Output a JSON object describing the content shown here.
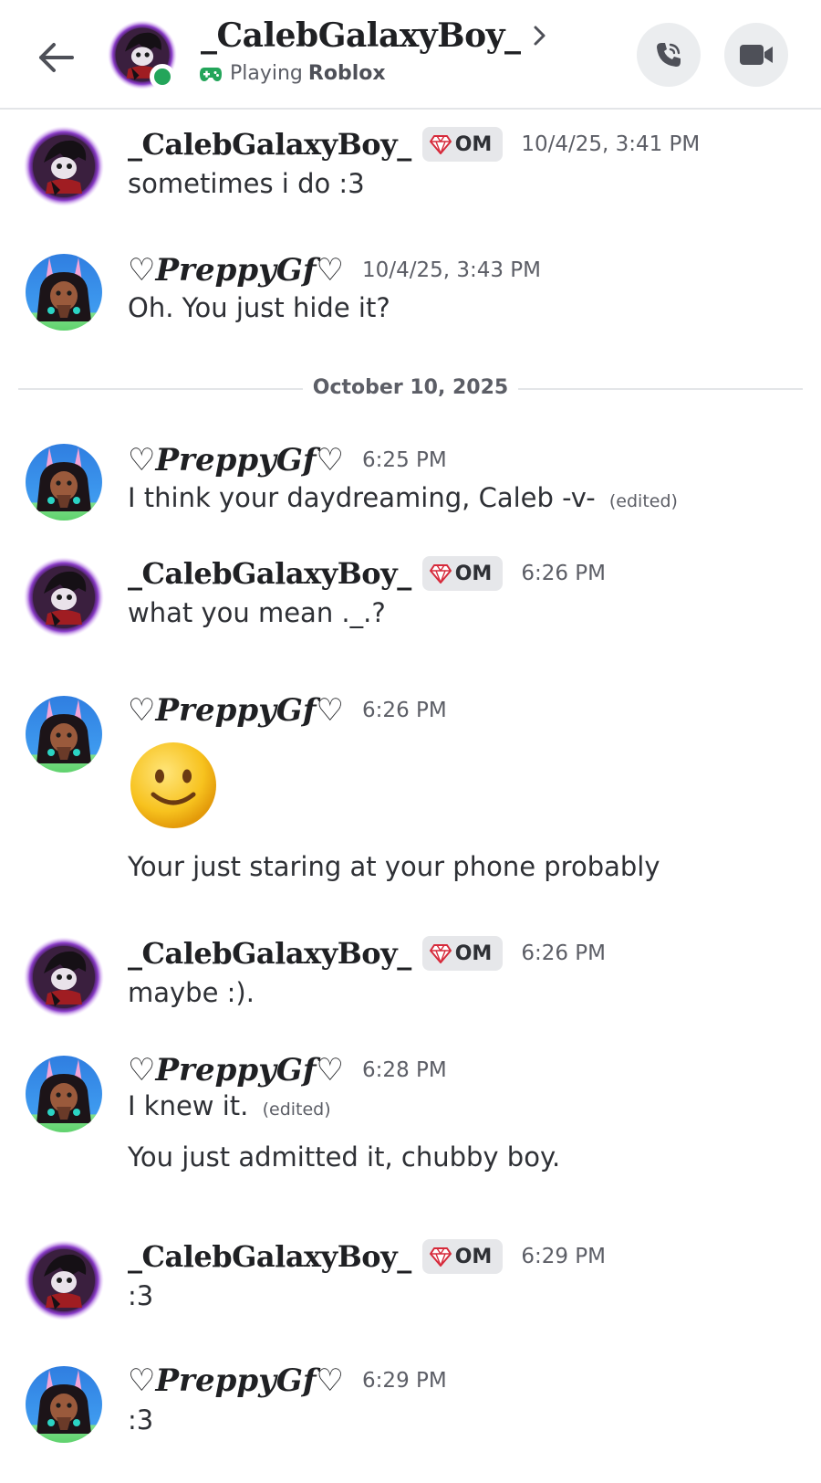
{
  "header": {
    "back_icon": "arrow-left-icon",
    "title": "_CalebGalaxyBoy_",
    "activity_prefix": "Playing",
    "activity_game": "Roblox",
    "status_color": "#23a55a",
    "call_icon": "phone-icon",
    "video_icon": "video-camera-icon"
  },
  "divider": {
    "label": "October 10, 2025"
  },
  "messages": [
    {
      "author": "_CalebGalaxyBoy_",
      "tag": "OM",
      "timestamp": "10/4/25, 3:41 PM",
      "lines": [
        "sometimes i do :3"
      ]
    },
    {
      "author": "♡PreppyGf♡",
      "timestamp": "10/4/25, 3:43 PM",
      "lines": [
        "Oh. You just hide it?"
      ]
    },
    {
      "author": "♡PreppyGf♡",
      "timestamp": "6:25 PM",
      "lines": [
        "I think your daydreaming, Caleb -v-"
      ],
      "edited": "(edited)"
    },
    {
      "author": "_CalebGalaxyBoy_",
      "tag": "OM",
      "timestamp": "6:26 PM",
      "lines": [
        "what you mean ._.?"
      ]
    },
    {
      "author": "♡PreppyGf♡",
      "timestamp": "6:26 PM",
      "emoji": "🙂",
      "lines": [
        "Your just staring at your phone probably"
      ]
    },
    {
      "author": "_CalebGalaxyBoy_",
      "tag": "OM",
      "timestamp": "6:26 PM",
      "lines": [
        "maybe :)."
      ]
    },
    {
      "author": "♡PreppyGf♡",
      "timestamp": "6:28 PM",
      "lines": [
        "I knew it.",
        "You just admitted it, chubby boy."
      ],
      "edited": "(edited)"
    },
    {
      "author": "_CalebGalaxyBoy_",
      "tag": "OM",
      "timestamp": "6:29 PM",
      "lines": [
        ":3"
      ]
    },
    {
      "author": "♡PreppyGf♡",
      "timestamp": "6:29 PM",
      "lines": [
        ":3"
      ]
    }
  ]
}
